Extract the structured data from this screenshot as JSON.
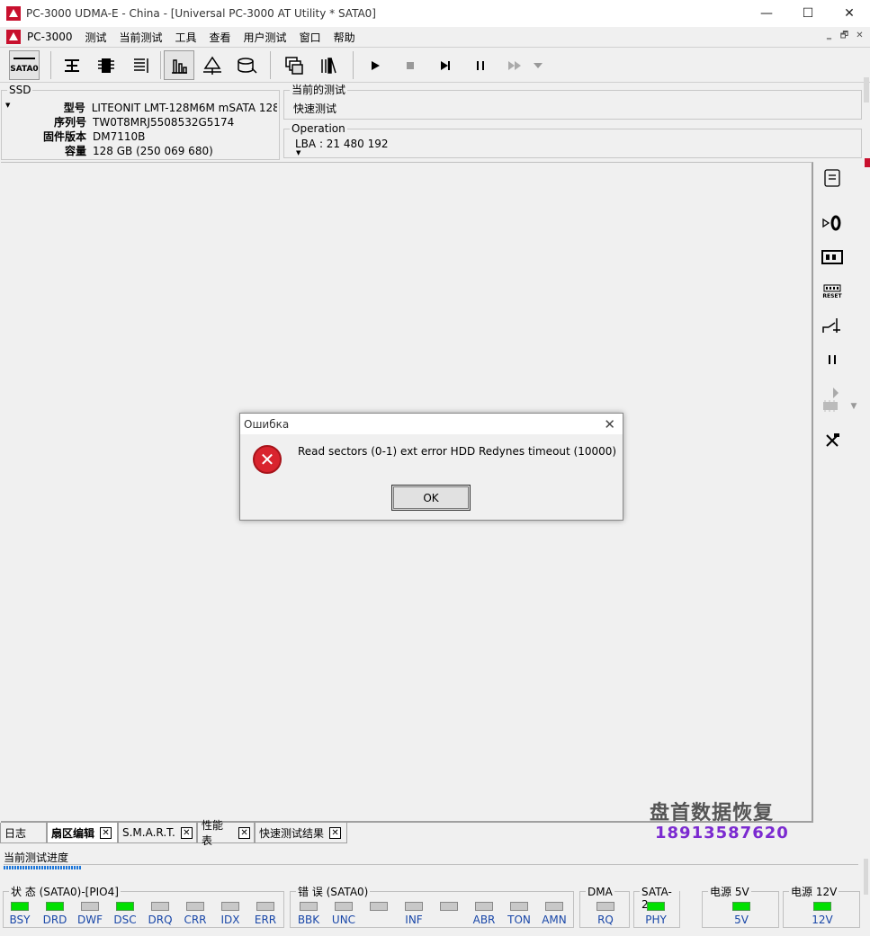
{
  "window": {
    "title": "PC-3000 UDMA-E - China - [Universal PC-3000 AT Utility * SATA0]",
    "minimize": "—",
    "maximize": "☐",
    "close": "✕"
  },
  "menu": {
    "app": "PC-3000",
    "items": [
      "测试",
      "当前测试",
      "工具",
      "查看",
      "用户测试",
      "窗口",
      "帮助"
    ],
    "mdi": [
      "‗",
      "🗗",
      "✕"
    ]
  },
  "toolbar": {
    "sata_label": "SATA0"
  },
  "ssd_panel": {
    "legend": "SSD",
    "rows": [
      {
        "label": "型号",
        "value": "LITEONIT LMT-128M6M mSATA 128"
      },
      {
        "label": "序列号",
        "value": "TW0T8MRJ5508532G5174"
      },
      {
        "label": "固件版本",
        "value": "DM7110B"
      },
      {
        "label": "容量",
        "value": "128 GB (250 069 680)"
      }
    ]
  },
  "current_test": {
    "legend": "当前的测试",
    "value": "快速测试"
  },
  "operation": {
    "legend": "Operation",
    "value": "LBA : 21 480 192"
  },
  "right_panel": {
    "reset_label": "RESET"
  },
  "dialog": {
    "title": "Ошибка",
    "message": "Read sectors (0-1) ext error HDD Redynes timeout (10000)",
    "ok_label": "OK",
    "close": "✕",
    "icon_glyph": "✕"
  },
  "tabs": [
    {
      "label": "日志",
      "active": false,
      "closable": false
    },
    {
      "label": "扇区编辑",
      "active": true,
      "closable": true
    },
    {
      "label": "S.M.A.R.T.",
      "active": false,
      "closable": true
    },
    {
      "label": "性能表",
      "active": false,
      "closable": true
    },
    {
      "label": "快速测试结果",
      "active": false,
      "closable": true
    }
  ],
  "watermark": {
    "text": "盘首数据恢复",
    "phone": "18913587620"
  },
  "progress": {
    "label": "当前测试进度",
    "fraction": 0.09
  },
  "status": {
    "state_group": {
      "legend": "状 态 (SATA0)-[PIO4]",
      "leds": [
        {
          "label": "BSY",
          "on": true
        },
        {
          "label": "DRD",
          "on": true
        },
        {
          "label": "DWF",
          "on": false
        },
        {
          "label": "DSC",
          "on": true
        },
        {
          "label": "DRQ",
          "on": false
        },
        {
          "label": "CRR",
          "on": false
        },
        {
          "label": "IDX",
          "on": false
        },
        {
          "label": "ERR",
          "on": false
        }
      ]
    },
    "error_group": {
      "legend": "错 误 (SATA0)",
      "leds": [
        {
          "label": "BBK",
          "on": false
        },
        {
          "label": "UNC",
          "on": false
        },
        {
          "label": "",
          "on": false
        },
        {
          "label": "INF",
          "on": false
        },
        {
          "label": "",
          "on": false
        },
        {
          "label": "ABR",
          "on": false
        },
        {
          "label": "TON",
          "on": false
        },
        {
          "label": "AMN",
          "on": false
        }
      ]
    },
    "dma_group": {
      "legend": "DMA",
      "leds": [
        {
          "label": "RQ",
          "on": false
        }
      ]
    },
    "sata_group": {
      "legend": "SATA-2",
      "leds": [
        {
          "label": "PHY",
          "on": true
        }
      ]
    },
    "power5_group": {
      "legend": "电源 5V",
      "leds": [
        {
          "label": "5V",
          "on": true
        }
      ]
    },
    "power12_group": {
      "legend": "电源 12V",
      "leds": [
        {
          "label": "12V",
          "on": true
        }
      ]
    }
  },
  "colors": {
    "led_on": "#00e000",
    "led_off": "#c8c8c8",
    "error_red": "#d9242e",
    "label_blue": "#1947a8"
  }
}
